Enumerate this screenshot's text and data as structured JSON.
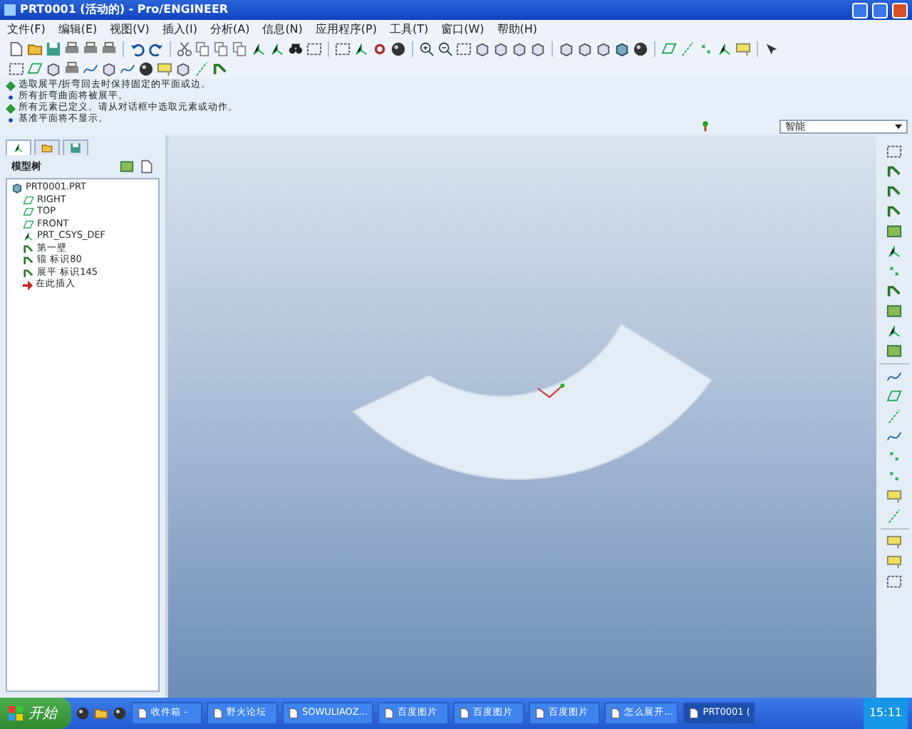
{
  "window": {
    "title": "PRT0001 (活动的) - Pro/ENGINEER"
  },
  "menu": [
    "文件(F)",
    "编辑(E)",
    "视图(V)",
    "插入(I)",
    "分析(A)",
    "信息(N)",
    "应用程序(P)",
    "工具(T)",
    "窗口(W)",
    "帮助(H)"
  ],
  "messages": [
    {
      "kind": "prompt",
      "text": "选取展平/折弯回去时保持固定的平面或边。"
    },
    {
      "kind": "info",
      "text": "所有折弯曲面将被展平。"
    },
    {
      "kind": "prompt",
      "text": "所有元素已定义。请从对话框中选取元素或动作。"
    },
    {
      "kind": "info",
      "text": "基准平面将不显示。"
    }
  ],
  "filter": {
    "value": "智能"
  },
  "nav_tabs": [
    {
      "selected": true
    },
    {
      "selected": false
    },
    {
      "selected": false
    }
  ],
  "model_tree": {
    "title": "模型树",
    "items": [
      {
        "kind": "part",
        "label": "PRT0001.PRT",
        "children": [
          {
            "kind": "plane",
            "label": "RIGHT"
          },
          {
            "kind": "plane",
            "label": "TOP"
          },
          {
            "kind": "plane",
            "label": "FRONT"
          },
          {
            "kind": "csys",
            "label": "PRT_CSYS_DEF"
          },
          {
            "kind": "feature",
            "label": "第一壁"
          },
          {
            "kind": "feature",
            "label": "辊 标识80"
          },
          {
            "kind": "feature",
            "label": "展平 标识145"
          },
          {
            "kind": "insert",
            "label": "在此插入"
          }
        ]
      }
    ]
  },
  "taskbar": {
    "start": "开始",
    "tasks": [
      {
        "label": "收件箱 -",
        "selected": false
      },
      {
        "label": "野火论坛",
        "selected": false
      },
      {
        "label": "SOWULIAOZ...",
        "selected": false
      },
      {
        "label": "百度图片",
        "selected": false
      },
      {
        "label": "百度图片",
        "selected": false
      },
      {
        "label": "百度图片",
        "selected": false
      },
      {
        "label": "怎么展开...",
        "selected": false
      },
      {
        "label": "PRT0001 (",
        "selected": true
      }
    ],
    "clock": "15:11"
  }
}
